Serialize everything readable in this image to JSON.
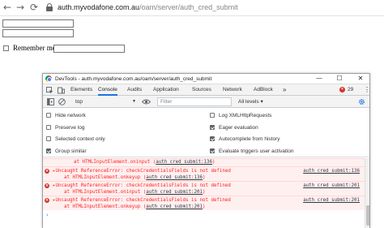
{
  "browser": {
    "back": "←",
    "forward": "→",
    "reload": "⟳",
    "url_host": "auth.myvodafone.com.au",
    "url_path": "/oam/server/auth_cred_submit"
  },
  "page": {
    "remember_label": "Remember me"
  },
  "devtools": {
    "title": "DevTools - auth.myvodafone.com.au/oam/server/auth_cred_submit",
    "window_buttons": {
      "minimize": "—",
      "maximize": "☐",
      "close": "✕"
    },
    "tabs": [
      "Elements",
      "Console",
      "Audits",
      "Application",
      "Sources",
      "Network",
      "AdBlock"
    ],
    "active_tab": "Console",
    "more_tabs": "»",
    "error_count": "29",
    "more_menu": "⋮",
    "toolbar": {
      "context": "top",
      "filter_placeholder": "Filter",
      "levels": "All levels ▾"
    },
    "settings_left": [
      {
        "label": "Hide network",
        "checked": false
      },
      {
        "label": "Preserve log",
        "checked": false
      },
      {
        "label": "Selected context only",
        "checked": false
      },
      {
        "label": "Group similar",
        "checked": true
      }
    ],
    "settings_right": [
      {
        "label": "Log XMLHttpRequests",
        "checked": false
      },
      {
        "label": "Eager evaluation",
        "checked": true
      },
      {
        "label": "Autocomplete from history",
        "checked": true
      },
      {
        "label": "Evaluate triggers user activation",
        "checked": true
      }
    ],
    "messages": [
      {
        "line1_prefix": "at HTMLInputElement.oninput (",
        "line1_link": "auth_cred_submit:136",
        "line1_suffix": ")"
      },
      {
        "line1": "▸Uncaught ReferenceError: checkCredentialsFields is not defined",
        "line2_prefix": "at HTMLInputElement.onkeyup (",
        "line2_link": "auth_cred_submit:136",
        "line2_suffix": ")",
        "source": "auth_cred_submit:136"
      },
      {
        "line1": "▸Uncaught ReferenceError: checkCredentialsFields is not defined",
        "line2_prefix": "at HTMLInputElement.oninput (",
        "line2_link": "auth_cred_submit:201",
        "line2_suffix": ")",
        "source": "auth_cred_submit:201"
      },
      {
        "line1": "▸Uncaught ReferenceError: checkCredentialsFields is not defined",
        "line2_prefix": "at HTMLInputElement.onkeyup (",
        "line2_link": "auth_cred_submit:201",
        "line2_suffix": ")",
        "source": "auth_cred_submit:201"
      }
    ],
    "prompt": "›"
  }
}
